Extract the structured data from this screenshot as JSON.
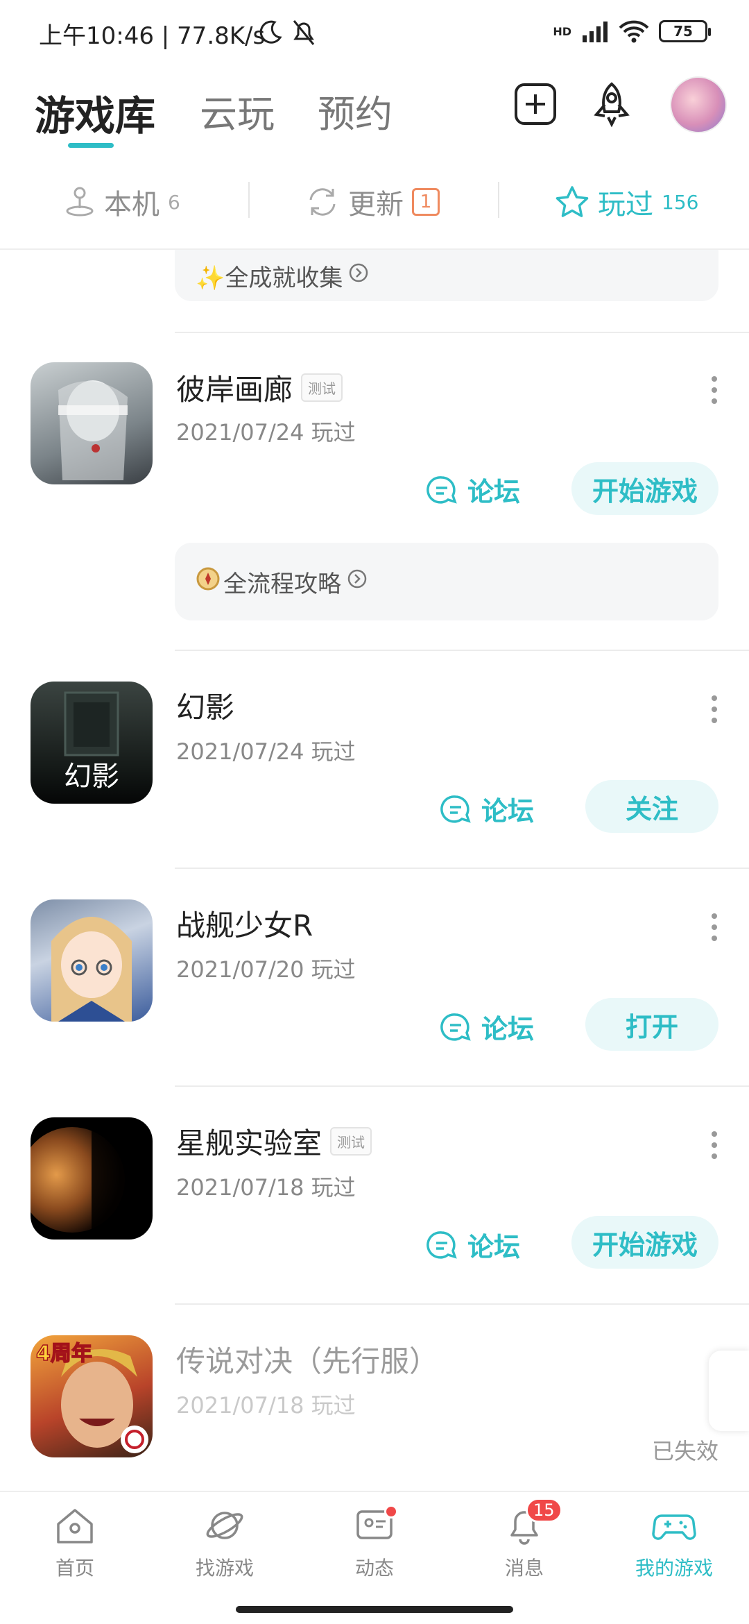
{
  "status_bar": {
    "time_speed": "上午10:46 | 77.8K/s",
    "signal": "HD",
    "battery": "75"
  },
  "header": {
    "tabs": [
      {
        "label": "游戏库"
      },
      {
        "label": "云玩"
      },
      {
        "label": "预约"
      }
    ],
    "add_icon": "add-square-icon",
    "rocket_icon": "rocket-icon"
  },
  "subtabs": {
    "local": {
      "label": "本机",
      "count": "6"
    },
    "update": {
      "label": "更新",
      "count": "1"
    },
    "played": {
      "label": "玩过",
      "count": "156"
    }
  },
  "top_card": {
    "label": "✨全成就收集"
  },
  "games": [
    {
      "name": "彼岸画廊",
      "tag": "测试",
      "date": "2021/07/24 玩过",
      "forum": "论坛",
      "action": "开始游戏",
      "guide": "全流程攻略"
    },
    {
      "name": "幻影",
      "icon_text": "幻影",
      "date": "2021/07/24 玩过",
      "forum": "论坛",
      "action": "关注"
    },
    {
      "name": "战舰少女R",
      "date": "2021/07/20 玩过",
      "forum": "论坛",
      "action": "打开"
    },
    {
      "name": "星舰实验室",
      "tag": "测试",
      "date": "2021/07/18 玩过",
      "forum": "论坛",
      "action": "开始游戏"
    },
    {
      "name": "传说对决（先行服）",
      "icon_text": "4周年",
      "date": "2021/07/18 玩过",
      "status": "已失效"
    }
  ],
  "bottom_nav": [
    {
      "label": "首页",
      "icon": "home-icon"
    },
    {
      "label": "找游戏",
      "icon": "planet-icon"
    },
    {
      "label": "动态",
      "icon": "feed-icon"
    },
    {
      "label": "消息",
      "icon": "bell-icon",
      "badge": "15"
    },
    {
      "label": "我的游戏",
      "icon": "gamepad-icon"
    }
  ],
  "colors": {
    "accent": "#2ebdc6",
    "badge": "#f04848",
    "update_badge": "#ef8a5f"
  }
}
